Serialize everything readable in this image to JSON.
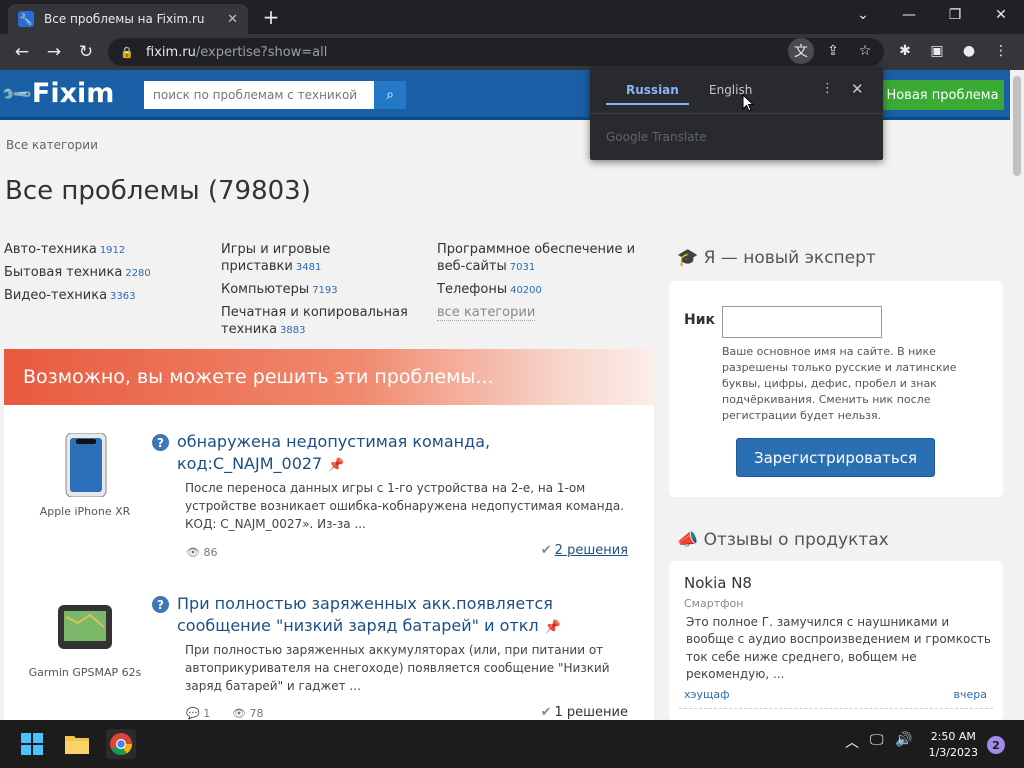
{
  "browser": {
    "tab_title": "Все проблемы на Fixim.ru",
    "url_host": "fixim.ru",
    "url_path": "/expertise?show=all"
  },
  "site": {
    "logo": "Fixim",
    "search_placeholder": "поиск по проблемам с техникой",
    "new_problem_label": "Новая проблема"
  },
  "translate": {
    "lang_source": "Russian",
    "lang_target": "English",
    "provider": "Google Translate"
  },
  "breadcrumb": "Все категории",
  "page_title": "Все проблемы (79803)",
  "categories": {
    "col1": [
      {
        "name": "Авто-техника",
        "count": "1912"
      },
      {
        "name": "Бытовая техника",
        "count": "2280"
      },
      {
        "name": "Видео-техника",
        "count": "3363"
      }
    ],
    "col2": [
      {
        "name": "Игры и игровые приставки",
        "count": "3481"
      },
      {
        "name": "Компьютеры",
        "count": "7193"
      },
      {
        "name": "Печатная и копировальная техника",
        "count": "3883"
      }
    ],
    "col3": [
      {
        "name": "Программное обеспечение и веб-сайты",
        "count": "7031"
      },
      {
        "name": "Телефоны",
        "count": "40200"
      }
    ],
    "all_label": "все категории"
  },
  "banner": "Возможно, вы можете решить эти проблемы...",
  "problems": [
    {
      "device": "Apple iPhone XR",
      "title": "обнаружена недопустимая команда, код:C_NAJM_0027",
      "desc": "После переноса данных игры с 1-го устройства на 2-е, на 1-ом устройстве возникает ошибка-кобнаружена недопустимая команда. КОД: C_NAJM_0027». Из-за ...",
      "views": "86",
      "solutions": "2 решения"
    },
    {
      "device": "Garmin GPSMAP 62s",
      "title": "При полностью заряженных акк.появляется сообщение \"низкий заряд батарей\" и откл",
      "desc": "При полностью заряженных аккумуляторах (или, при питании от автоприкуривателя на снегоходе) появляется сообщение \"Низкий заряд батарей\" и гаджет ...",
      "comments": "1",
      "views": "78",
      "solutions": "1 решение"
    }
  ],
  "expert": {
    "header": "Я — новый эксперт",
    "nick_label": "Ник",
    "hint": "Ваше основное имя на сайте. В нике разрешены только русские и латинские буквы, цифры, дефис, пробел и знак подчёркивания. Сменить ник после регистрации будет нельзя.",
    "register_label": "Зарегистрироваться"
  },
  "reviews": {
    "header": "Отзывы о продуктах",
    "product": "Nokia N8",
    "category": "Смартфон",
    "text": "Это полное Г. замучился с наушниками и вообще с аудио воспроизведением и громкость ток себе ниже среднего, вобщем не рекомендую, ...",
    "author": "хэущаф",
    "date": "вчера"
  },
  "taskbar": {
    "time": "2:50 AM",
    "date": "1/3/2023",
    "notifications": "2"
  },
  "colors": {
    "site_header": "#1a5fa5",
    "new_problem_button": "#3aaa35",
    "banner": "#e85a3f",
    "link": "#1d4f86"
  }
}
